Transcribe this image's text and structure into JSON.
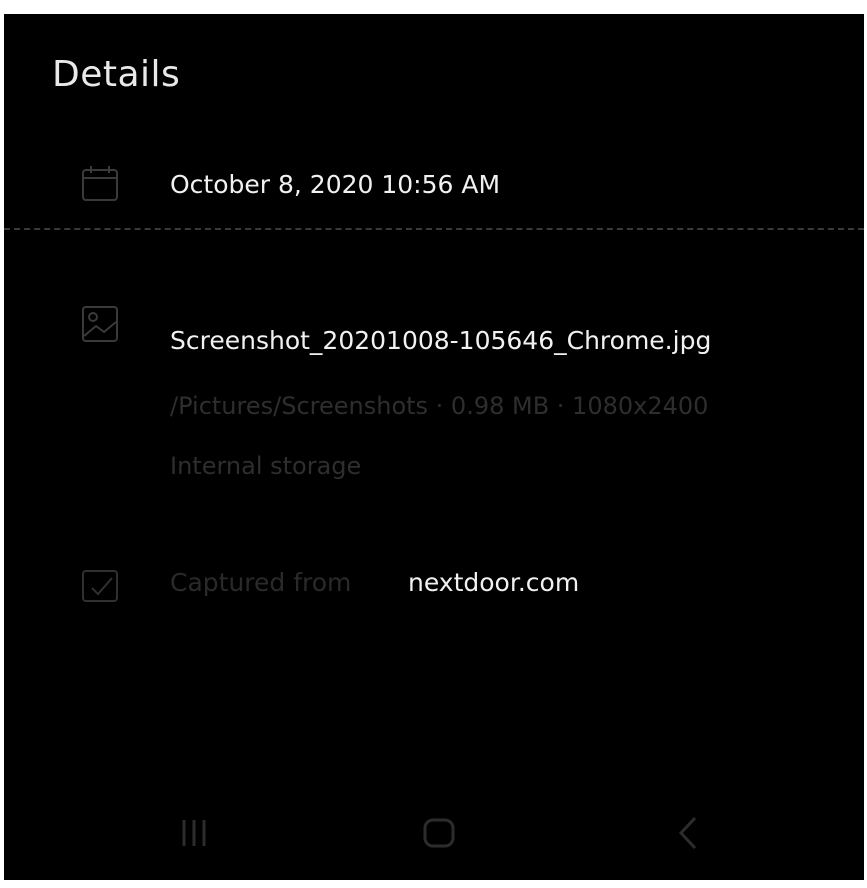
{
  "header": {
    "title": "Details"
  },
  "details": {
    "date_time": "October 8, 2020 10:56 AM",
    "file_name": "Screenshot_20201008-105646_Chrome.jpg",
    "file_info_line1": "/Pictures/Screenshots · 0.98 MB · 1080x2400",
    "file_info_line2": "Internal storage",
    "captured_label": "Captured from",
    "captured_value": "nextdoor.com"
  },
  "icons": {
    "calendar": "calendar-icon",
    "image": "image-icon",
    "capture": "capture-icon",
    "recents": "recent-apps-icon",
    "home": "home-icon",
    "back": "back-icon"
  },
  "colors": {
    "background": "#000000",
    "primary_text": "#f1f1f1",
    "dim_text": "#2e2e2e"
  }
}
